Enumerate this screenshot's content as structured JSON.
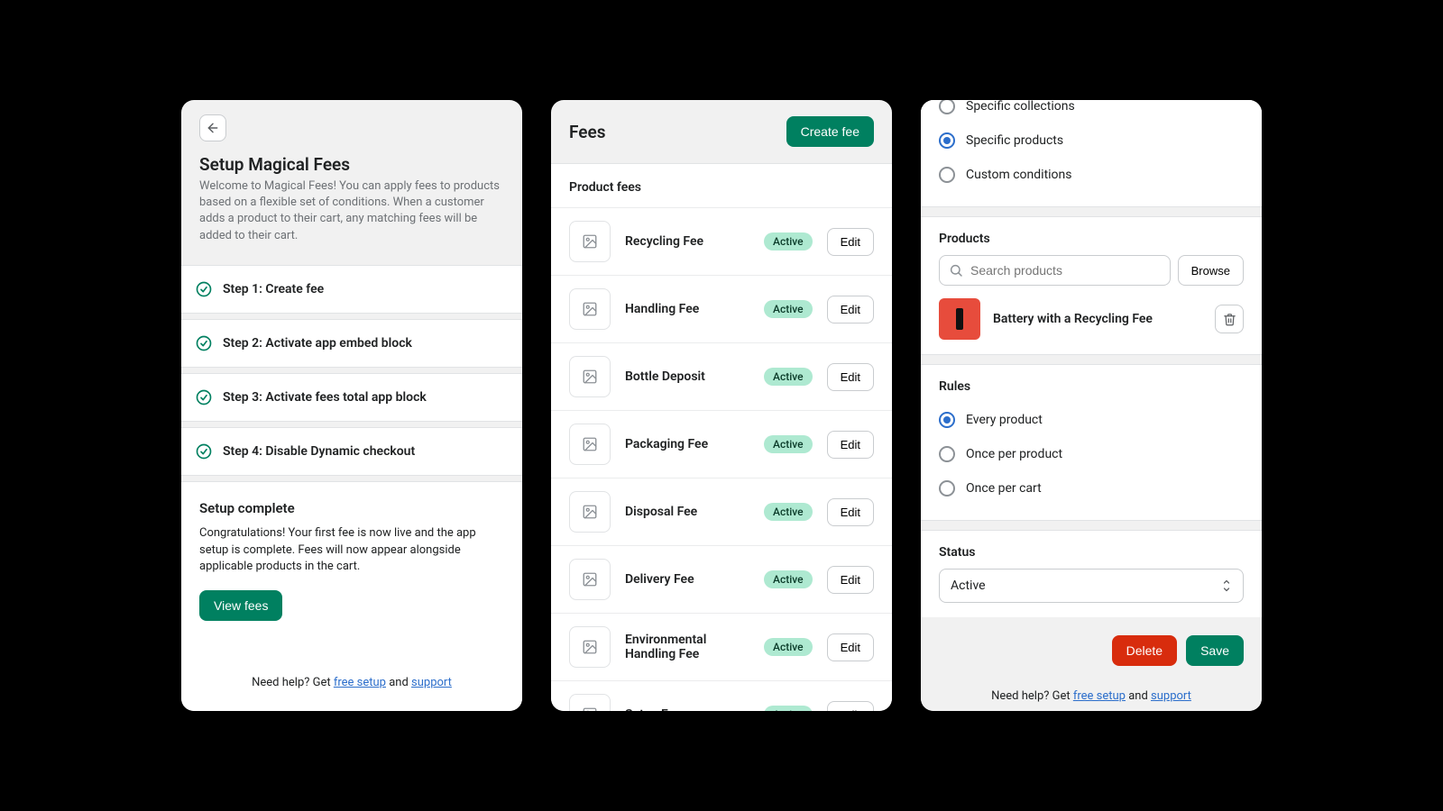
{
  "panel1": {
    "title": "Setup Magical Fees",
    "subtitle": "Welcome to Magical Fees! You can apply fees to products based on a flexible set of conditions. When a customer adds a product to their cart, any matching fees will be added to their cart.",
    "steps": [
      "Step 1: Create fee",
      "Step 2: Activate app embed block",
      "Step 3: Activate fees total app block",
      "Step 4: Disable Dynamic checkout"
    ],
    "complete_title": "Setup complete",
    "complete_text": "Congratulations! Your first fee is now live and the app setup is complete. Fees will now appear alongside applicable products in the cart.",
    "view_fees_label": "View fees",
    "help_prefix": "Need help? Get ",
    "help_link1": "free setup",
    "help_mid": " and ",
    "help_link2": "support"
  },
  "panel2": {
    "title": "Fees",
    "create_label": "Create fee",
    "list_title": "Product fees",
    "edit_label": "Edit",
    "active_label": "Active",
    "fees": [
      {
        "name": "Recycling Fee"
      },
      {
        "name": "Handling Fee"
      },
      {
        "name": "Bottle Deposit"
      },
      {
        "name": "Packaging Fee"
      },
      {
        "name": "Disposal Fee"
      },
      {
        "name": "Delivery Fee"
      },
      {
        "name": "Environmental Handling Fee"
      },
      {
        "name": "Setup Fee"
      }
    ]
  },
  "panel3": {
    "apply_to": {
      "options": [
        {
          "label": "Specific collections",
          "selected": false
        },
        {
          "label": "Specific products",
          "selected": true
        },
        {
          "label": "Custom conditions",
          "selected": false
        }
      ]
    },
    "products_title": "Products",
    "search_placeholder": "Search products",
    "browse_label": "Browse",
    "product_name": "Battery with a Recycling Fee",
    "rules_title": "Rules",
    "rules_options": [
      {
        "label": "Every product",
        "selected": true
      },
      {
        "label": "Once per product",
        "selected": false
      },
      {
        "label": "Once per cart",
        "selected": false
      }
    ],
    "status_title": "Status",
    "status_value": "Active",
    "delete_label": "Delete",
    "save_label": "Save",
    "help_prefix": "Need help? Get ",
    "help_link1": "free setup",
    "help_mid": " and ",
    "help_link2": "support"
  }
}
